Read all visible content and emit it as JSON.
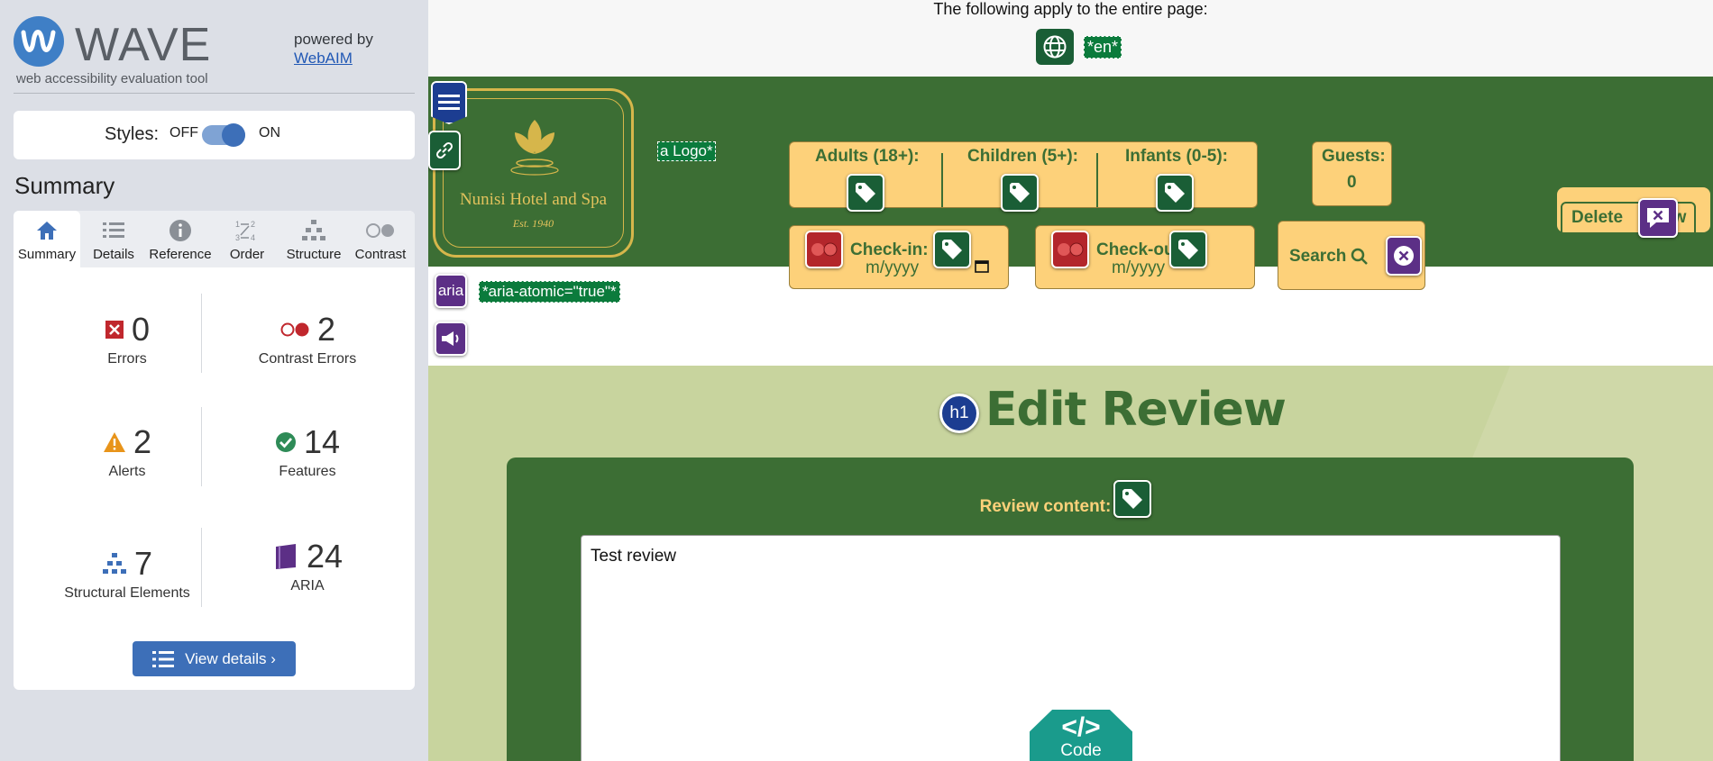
{
  "wave": {
    "logo_text": "WAVE",
    "tagline": "web accessibility evaluation tool",
    "powered_by": "powered by",
    "powered_link": "WebAIM",
    "styles_label": "Styles:",
    "styles_off": "OFF",
    "styles_on": "ON",
    "summary_heading": "Summary",
    "tabs": [
      {
        "label": "Summary",
        "icon": "home-icon",
        "active": true
      },
      {
        "label": "Details",
        "icon": "list-icon"
      },
      {
        "label": "Reference",
        "icon": "info-icon"
      },
      {
        "label": "Order",
        "icon": "order-icon"
      },
      {
        "label": "Structure",
        "icon": "structure-icon"
      },
      {
        "label": "Contrast",
        "icon": "contrast-icon"
      }
    ],
    "stats": {
      "errors": {
        "count": "0",
        "label": "Errors",
        "color": "#c0272d"
      },
      "contrast": {
        "count": "2",
        "label": "Contrast Errors",
        "color": "#c0272d"
      },
      "alerts": {
        "count": "2",
        "label": "Alerts",
        "color": "#e8941a"
      },
      "features": {
        "count": "14",
        "label": "Features",
        "color": "#2e8b57"
      },
      "structural": {
        "count": "7",
        "label": "Structural Elements",
        "color": "#3d6fb8"
      },
      "aria": {
        "count": "24",
        "label": "ARIA",
        "color": "#5c2f86"
      }
    },
    "view_details": "View details ›"
  },
  "page": {
    "notice": "The following apply to the entire page:",
    "lang_tag": "*en*",
    "logo_name": "Nunisi Hotel and Spa",
    "logo_est": "Est. 1940",
    "logo_alt_tag": "a Logo*",
    "aria_tag": "*aria-atomic=\"true\"*",
    "aria_icon_label": "aria",
    "booking": {
      "adults": "Adults (18+):",
      "children": "Children (5+):",
      "infants": "Infants (0-5):",
      "guests_label": "Guests:",
      "guests_value": "0",
      "checkin": "Check-in:",
      "checkout": "Check-out:",
      "date_placeholder_in": "m/yyyy",
      "date_placeholder_out": "m/yyyy",
      "search": "Search"
    },
    "delete_label": "Delete",
    "delete_tail": "ew",
    "h1_badge": "h1",
    "title": "Edit Review",
    "review_label": "Review content:",
    "review_value": "Test review",
    "code_sym": "</>",
    "code_label": "Code"
  },
  "colors": {
    "brand_blue": "#3d6fb8",
    "header_green": "#3c6e34",
    "field_yellow": "#fdd17a"
  }
}
